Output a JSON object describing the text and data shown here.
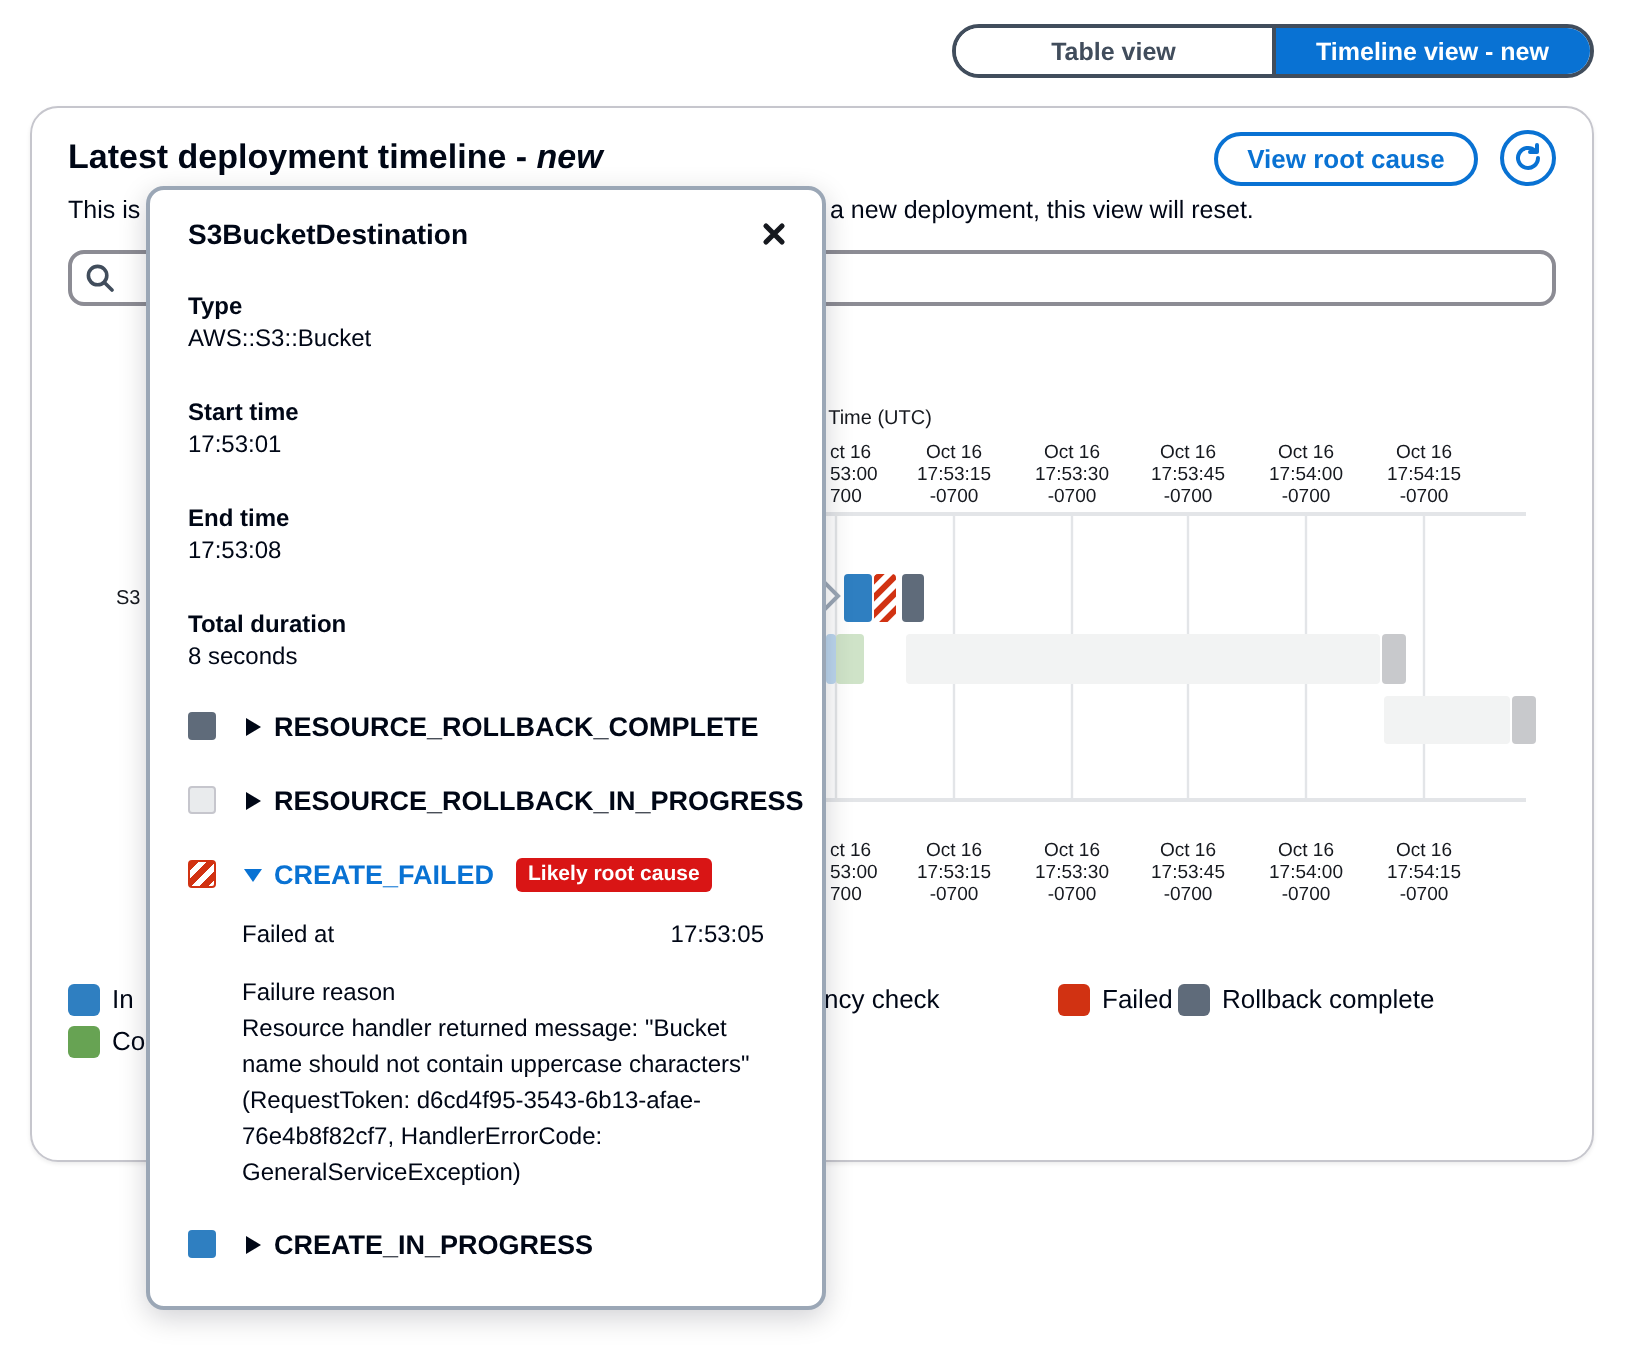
{
  "view_toggle": [
    {
      "label": "Table view",
      "selected": false
    },
    {
      "label": "Timeline view - new",
      "selected": true
    }
  ],
  "panel": {
    "title": "Latest deployment timeline - *new*",
    "view_root_cause_button": "View root cause",
    "description": [
      {
        "text": "This is"
      },
      {
        "text": "a new deployment, this view will reset."
      }
    ],
    "timeline": {
      "axis_title": "Time (UTC)",
      "row_labels": [
        "S3"
      ],
      "top_ticks": [
        {
          "lines": [
            "ct 16",
            "53:00",
            "700"
          ]
        },
        {
          "lines": [
            "Oct 16",
            "17:53:15",
            "-0700"
          ]
        },
        {
          "lines": [
            "Oct 16",
            "17:53:30",
            "-0700"
          ]
        },
        {
          "lines": [
            "Oct 16",
            "17:53:45",
            "-0700"
          ]
        },
        {
          "lines": [
            "Oct 16",
            "17:54:00",
            "-0700"
          ]
        },
        {
          "lines": [
            "Oct 16",
            "17:54:15",
            "-0700"
          ]
        }
      ],
      "bottom_ticks": [
        {
          "lines": [
            "ct 16",
            "53:00",
            "700"
          ]
        },
        {
          "lines": [
            "Oct 16",
            "17:53:15",
            "-0700"
          ]
        },
        {
          "lines": [
            "Oct 16",
            "17:53:30",
            "-0700"
          ]
        },
        {
          "lines": [
            "Oct 16",
            "17:53:45",
            "-0700"
          ]
        },
        {
          "lines": [
            "Oct 16",
            "17:54:00",
            "-0700"
          ]
        },
        {
          "lines": [
            "Oct 16",
            "17:54:15",
            "-0700"
          ]
        }
      ]
    },
    "legend": [
      {
        "label": "In",
        "color": "#2f7fc1"
      },
      {
        "label": "ncy check"
      },
      {
        "label": "Failed",
        "color": "#d13212"
      },
      {
        "label": "Rollback complete",
        "color": "#5f6b7a"
      },
      {
        "label": "Co",
        "color": "#67a353"
      }
    ]
  },
  "popover": {
    "title": "S3BucketDestination",
    "fields": [
      {
        "label": "Type",
        "value": "AWS::S3::Bucket"
      },
      {
        "label": "Start time",
        "value": "17:53:01"
      },
      {
        "label": "End time",
        "value": "17:53:08"
      },
      {
        "label": "Total duration",
        "value": "8 seconds"
      }
    ],
    "events": [
      {
        "kind": "rollback_complete",
        "label": "RESOURCE_ROLLBACK_COMPLETE",
        "expanded": false
      },
      {
        "kind": "rollback_in_progress",
        "label": "RESOURCE_ROLLBACK_IN_PROGRESS",
        "expanded": false
      },
      {
        "kind": "failed",
        "label": "CREATE_FAILED",
        "expanded": true,
        "badge": "Likely root cause",
        "details": {
          "failed_at_label": "Failed at",
          "failed_at": "17:53:05",
          "reason_label": "Failure reason",
          "reason": "Resource handler returned message: \"Bucket name should not contain uppercase characters\" (RequestToken: d6cd4f95-3543-6b13-afae-76e4b8f82cf7, HandlerErrorCode: GeneralServiceException)"
        }
      },
      {
        "kind": "in_progress",
        "label": "CREATE_IN_PROGRESS",
        "expanded": false
      }
    ]
  }
}
